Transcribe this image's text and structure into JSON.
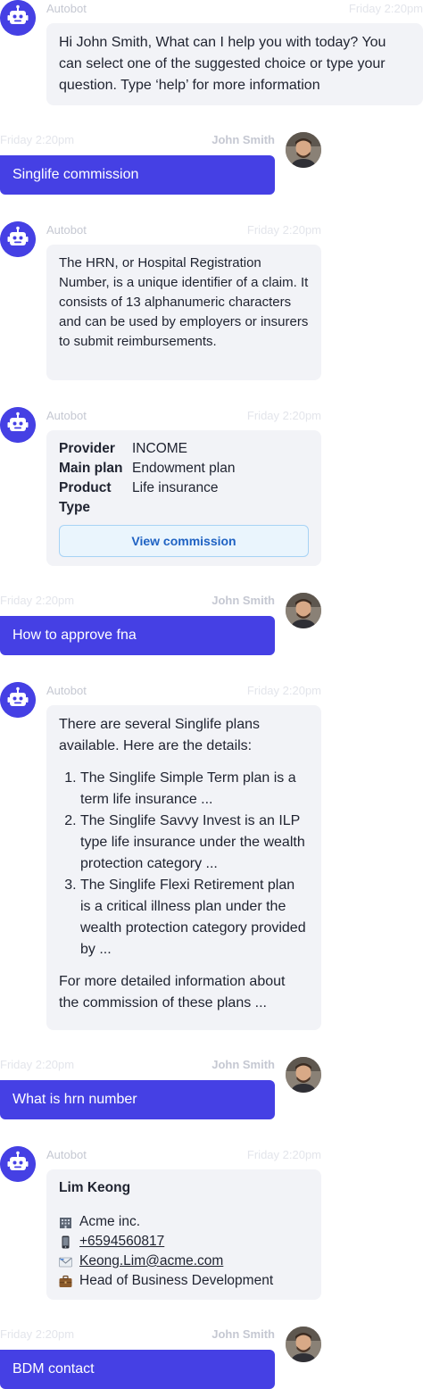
{
  "messages": {
    "m1": {
      "sender": "Autobot",
      "time": "Friday 2:20pm",
      "text": "Hi John Smith, What can I help you with today? You can select one of the suggested choice or type your question. Type ‘help’ for more information"
    },
    "m2": {
      "sender": "John Smith",
      "time": "Friday 2:20pm",
      "text": "Singlife commission"
    },
    "m3": {
      "sender": "Autobot",
      "time": "Friday 2:20pm",
      "text": "The HRN, or Hospital Registration Number, is a unique identifier of a claim. It consists of 13 alphanumeric characters and can be used by employers or insurers to submit reimbursements."
    },
    "m4": {
      "sender": "Autobot",
      "time": "Friday 2:20pm",
      "rows": [
        {
          "key": "Provider",
          "value": "INCOME"
        },
        {
          "key": "Main plan",
          "value": "Endowment plan"
        },
        {
          "key": "Product Type",
          "value": "Life insurance"
        }
      ],
      "button": "View commission"
    },
    "m5": {
      "sender": "John Smith",
      "time": "Friday 2:20pm",
      "text": "How to approve fna"
    },
    "m6": {
      "sender": "Autobot",
      "time": "Friday 2:20pm",
      "intro": "There are several Singlife plans available. Here are the details:",
      "items": [
        "The Singlife Simple Term plan is a term life insurance ...",
        "The Singlife Savvy Invest is an ILP type life insurance under the wealth protection category ...",
        "The Singlife Flexi Retirement plan is a critical illness plan under the wealth protection category provided by ..."
      ],
      "outro": "For more detailed information about the commission of these plans ..."
    },
    "m7": {
      "sender": "John Smith",
      "time": "Friday 2:20pm",
      "text": "What is hrn number"
    },
    "m8": {
      "sender": "Autobot",
      "time": "Friday 2:20pm",
      "name": "Lim Keong",
      "company": "Acme inc.",
      "phone": "+6594560817",
      "email": "Keong.Lim@acme.com",
      "role": "Head of Business Development"
    },
    "m9": {
      "sender": "John Smith",
      "time": "Friday 2:20pm",
      "text": "BDM contact"
    }
  },
  "colors": {
    "accent": "#4540e4",
    "bubble_bg": "#f2f3f7",
    "link_blue": "#1f62c3"
  },
  "icons": {
    "bot": "robot-icon",
    "user": "user-photo",
    "company": "building-icon",
    "phone": "mobile-phone-icon",
    "email": "envelope-icon",
    "role": "briefcase-icon"
  }
}
